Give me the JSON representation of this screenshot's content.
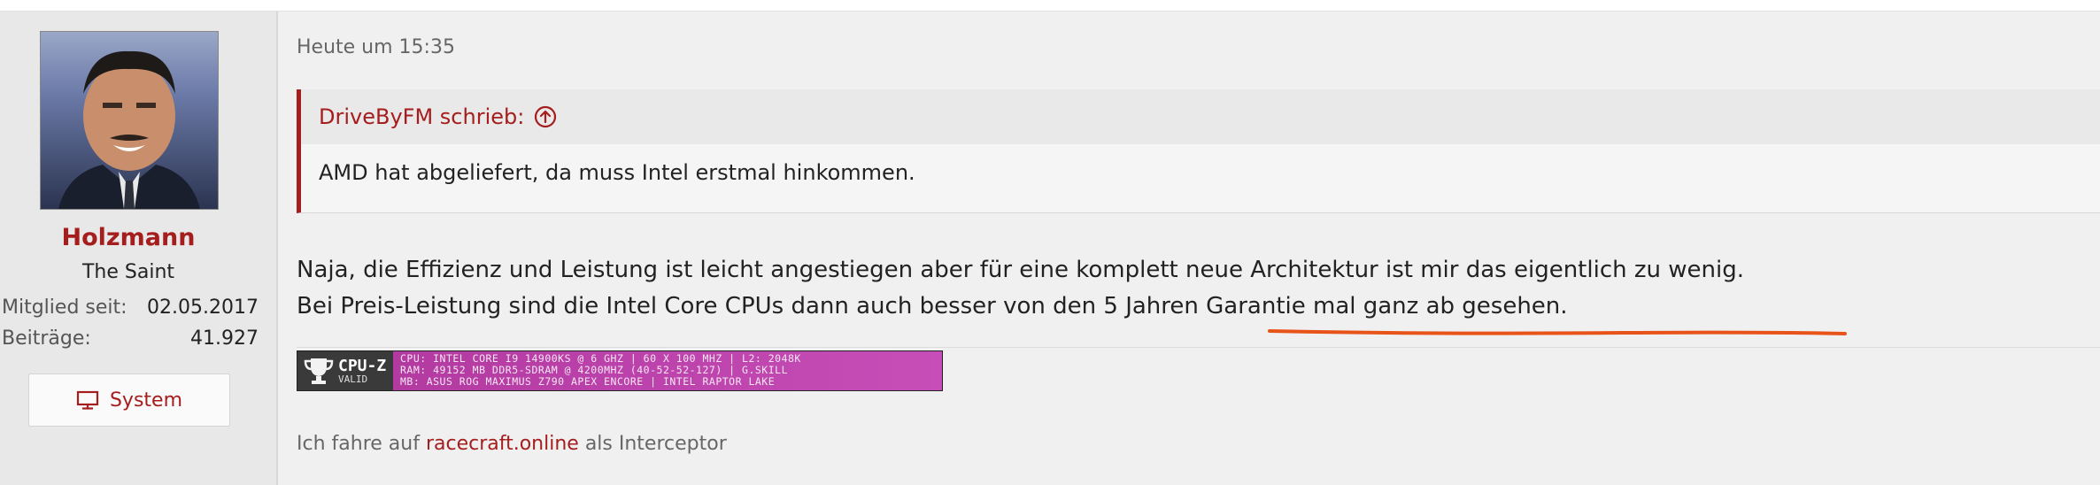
{
  "user": {
    "name": "Holzmann",
    "title": "The Saint",
    "stats": [
      {
        "label": "Mitglied seit:",
        "value": "02.05.2017"
      },
      {
        "label": "Beiträge:",
        "value": "41.927"
      }
    ],
    "system_button_label": "System"
  },
  "post": {
    "date": "Heute um 15:35",
    "quote": {
      "author_line": "DriveByFM schrieb:",
      "text": "AMD hat abgeliefert, da muss Intel erstmal hinkommen."
    },
    "body_lines": [
      "Naja, die Effizienz und Leistung ist leicht angestiegen aber für eine komplett neue Architektur ist mir das eigentlich zu wenig.",
      "Bei Preis-Leistung sind die Intel Core CPUs dann auch besser von den 5 Jahren Garantie mal ganz ab gesehen."
    ],
    "underline_color": "#e8531a"
  },
  "signature": {
    "cpuz_logo": "CPU-Z",
    "cpuz_valid": "VALID",
    "cpuz_lines": [
      "CPU: INTEL CORE I9 14900KS @ 6 GHZ | 60 X 100 MHZ | L2: 2048K",
      "RAM: 49152 MB DDR5-SDRAM @ 4200MHZ (40-52-52-127) | G.SKILL",
      "MB: ASUS ROG MAXIMUS Z790 APEX ENCORE | INTEL RAPTOR LAKE"
    ],
    "text_before": "Ich fahre auf",
    "link_text": "racecraft.online",
    "text_after": "als Interceptor"
  },
  "colors": {
    "accent": "#a51d1d",
    "cpuz_bg": "#c04aae"
  }
}
